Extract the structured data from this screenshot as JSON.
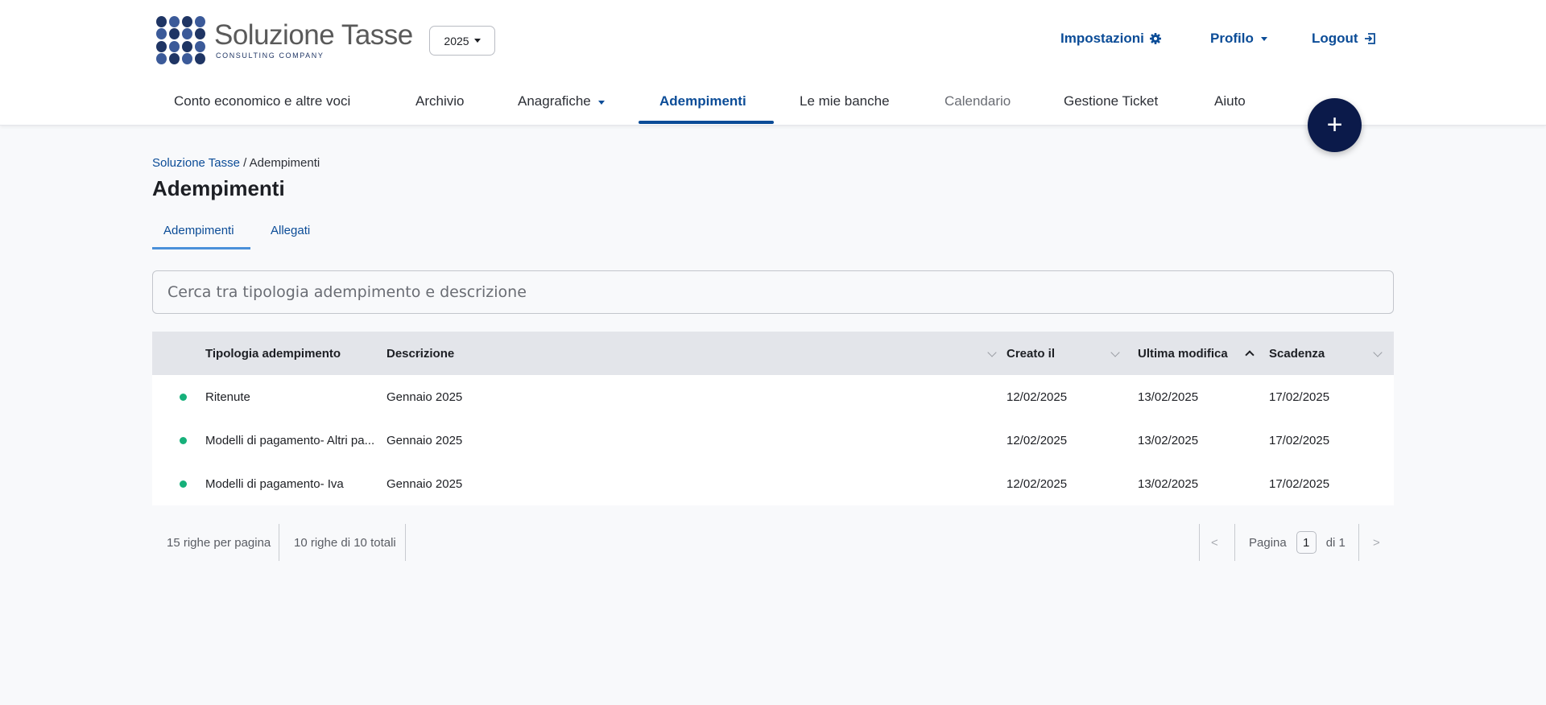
{
  "brand": {
    "name": "Soluzione Tasse",
    "subtitle": "CONSULTING COMPANY"
  },
  "year_select": {
    "value": "2025"
  },
  "top_links": {
    "settings": "Impostazioni",
    "profile": "Profilo",
    "logout": "Logout"
  },
  "nav": {
    "items": [
      {
        "label": "Conto economico e altre voci"
      },
      {
        "label": "Archivio"
      },
      {
        "label": "Anagrafiche"
      },
      {
        "label": "Adempimenti"
      },
      {
        "label": "Le mie banche"
      },
      {
        "label": "Calendario"
      },
      {
        "label": "Gestione Ticket"
      },
      {
        "label": "Aiuto"
      }
    ],
    "active": "Adempimenti"
  },
  "fab": {
    "label": "+"
  },
  "breadcrumb": {
    "root": "Soluzione Tasse",
    "separator": " / ",
    "current": "Adempimenti"
  },
  "page_title": "Adempimenti",
  "subtabs": [
    {
      "label": "Adempimenti"
    },
    {
      "label": "Allegati"
    }
  ],
  "search": {
    "placeholder": "Cerca tra tipologia adempimento e descrizione"
  },
  "table": {
    "columns": [
      "Tipologia adempimento",
      "Descrizione",
      "Creato il",
      "Ultima modifica",
      "Scadenza"
    ],
    "sorted_column": "Ultima modifica",
    "rows": [
      {
        "tipologia": "Ritenute",
        "descrizione": "Gennaio 2025",
        "creato": "12/02/2025",
        "modifica": "13/02/2025",
        "scadenza": "17/02/2025",
        "status_color": "#16b07a"
      },
      {
        "tipologia": "Modelli di pagamento- Altri pa...",
        "descrizione": "Gennaio 2025",
        "creato": "12/02/2025",
        "modifica": "13/02/2025",
        "scadenza": "17/02/2025",
        "status_color": "#16b07a"
      },
      {
        "tipologia": "Modelli di pagamento- Iva",
        "descrizione": "Gennaio 2025",
        "creato": "12/02/2025",
        "modifica": "13/02/2025",
        "scadenza": "17/02/2025",
        "status_color": "#16b07a"
      }
    ]
  },
  "pager": {
    "rows_per_page": "15 righe per pagina",
    "rows_total": "10 righe di 10 totali",
    "prev": "<",
    "page_label": "Pagina",
    "page_value": "1",
    "page_of": "di 1",
    "next": ">"
  },
  "colors": {
    "primary": "#0b4c97",
    "fab": "#0b1a4a",
    "status_ok": "#16b07a",
    "header_row": "#e3e5ea"
  }
}
